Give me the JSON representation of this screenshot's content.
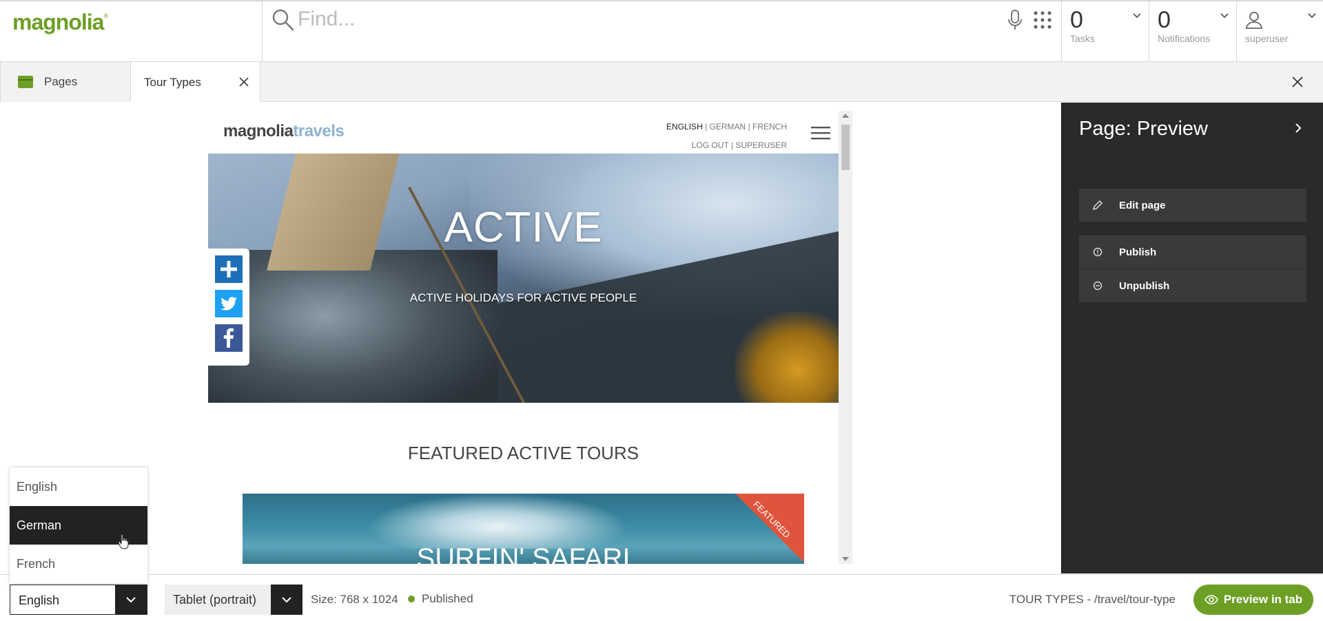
{
  "app": {
    "logo_text": "magnolia",
    "brand_color": "#6d9f25"
  },
  "search": {
    "placeholder": "Find..."
  },
  "header": {
    "tasks": {
      "count": "0",
      "label": "Tasks"
    },
    "notifications": {
      "count": "0",
      "label": "Notifications"
    },
    "user": {
      "name": "superuser"
    }
  },
  "tabs": [
    {
      "label": "Pages",
      "icon": "pages-app-icon",
      "active": false
    },
    {
      "label": "Tour Types",
      "icon": "close-icon",
      "active": true
    }
  ],
  "site": {
    "logo_part1": "magnolia",
    "logo_part2": "travels",
    "lang_english": "ENGLISH",
    "lang_german": "GERMAN",
    "lang_french": "FRENCH",
    "lang_sep": " | ",
    "logout": "LOG OUT",
    "user": "SUPERUSER",
    "hero_title": "ACTIVE",
    "hero_subtitle": "ACTIVE HOLIDAYS FOR ACTIVE PEOPLE",
    "section_title": "FEATURED ACTIVE TOURS",
    "card_title": "SURFIN' SAFARI",
    "card_ribbon": "FEATURED"
  },
  "action_panel": {
    "title": "Page: Preview",
    "actions": [
      {
        "label": "Edit page",
        "icon": "pencil-icon"
      },
      {
        "label": "Publish",
        "icon": "publish-icon"
      },
      {
        "label": "Unpublish",
        "icon": "unpublish-icon"
      }
    ]
  },
  "bottom": {
    "language_value": "English",
    "language_options": [
      "English",
      "German",
      "French"
    ],
    "hovered_option": "German",
    "device_value": "Tablet (portrait)",
    "size_label": "Size: 768 x 1024",
    "status": "Published",
    "status_color": "#6d9f25",
    "path": "TOUR TYPES - /travel/tour-type",
    "preview_button": "Preview in tab"
  }
}
